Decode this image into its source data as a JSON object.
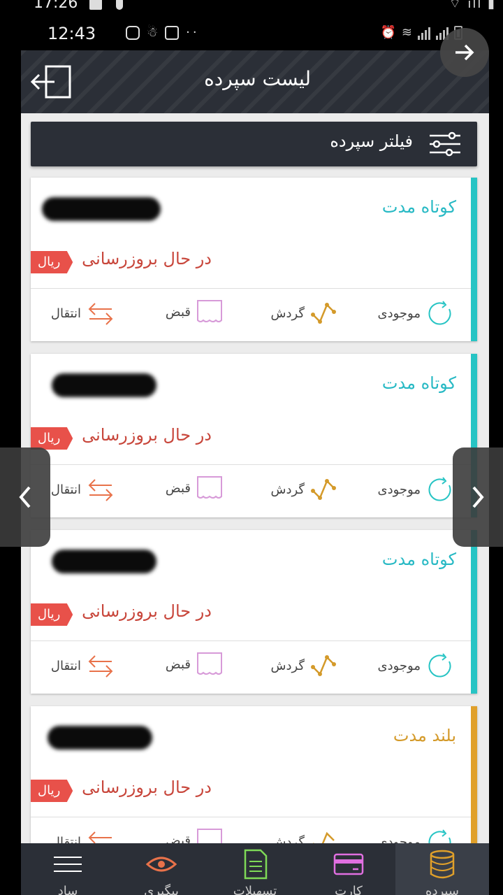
{
  "outer_status": {
    "time": "17:26"
  },
  "status_bar": {
    "time": "12:43"
  },
  "header": {
    "title": "لیست سپرده"
  },
  "filter": {
    "label": "فیلتر سپرده"
  },
  "cards": [
    {
      "type": "کوتاه مدت",
      "type_color": "#27b9c4",
      "stripe_color": "#27c4c4",
      "status": "در حال بروزرسانی",
      "currency": "ریال"
    },
    {
      "type": "کوتاه مدت",
      "type_color": "#27b9c4",
      "stripe_color": "#27c4c4",
      "status": "در حال بروزرسانی",
      "currency": "ریال"
    },
    {
      "type": "کوتاه مدت",
      "type_color": "#27b9c4",
      "stripe_color": "#27c4c4",
      "status": "در حال بروزرسانی",
      "currency": "ریال"
    },
    {
      "type": "بلند مدت",
      "type_color": "#d49a2a",
      "stripe_color": "#e0a02a",
      "status": "در حال بروزرسانی",
      "currency": "ریال"
    }
  ],
  "actions": {
    "balance": "موجودی",
    "turnover": "گردش",
    "receipt": "قبض",
    "transfer": "انتقال"
  },
  "bottom_nav": [
    {
      "label": "ساد",
      "icon": "menu-icon"
    },
    {
      "label": "پیگیری",
      "icon": "eye-icon"
    },
    {
      "label": "تسهیلات",
      "icon": "document-icon"
    },
    {
      "label": "کارت",
      "icon": "card-icon"
    },
    {
      "label": "سپرده",
      "icon": "coins-icon"
    }
  ],
  "colors": {
    "header_bg": "#2b2f37",
    "accent_red": "#e8514a",
    "teal": "#27c4c4",
    "gold": "#e0a02a"
  }
}
